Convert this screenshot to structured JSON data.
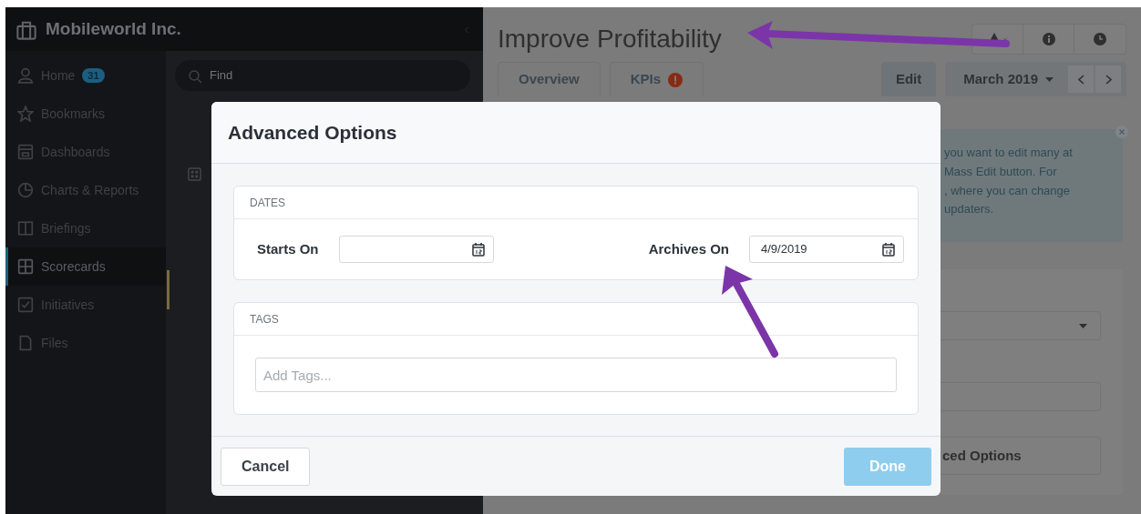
{
  "sidebar": {
    "org_name": "Mobileworld Inc.",
    "items": [
      {
        "label": "Home",
        "badge": "31",
        "selected": false
      },
      {
        "label": "Bookmarks",
        "selected": false
      },
      {
        "label": "Dashboards",
        "selected": false
      },
      {
        "label": "Charts & Reports",
        "selected": false
      },
      {
        "label": "Briefings",
        "selected": false
      },
      {
        "label": "Scorecards",
        "selected": true
      },
      {
        "label": "Initiatives",
        "selected": false
      },
      {
        "label": "Files",
        "selected": false
      }
    ]
  },
  "panel": {
    "search": {
      "placeholder": "Find"
    }
  },
  "page": {
    "title": "Improve Profitability",
    "tabs": [
      {
        "label": "Overview",
        "selected": false,
        "alert": false
      },
      {
        "label": "KPIs",
        "selected": false,
        "alert": true
      }
    ],
    "edit_button": "Edit",
    "period": "March 2019",
    "notice": "you want to edit many at\nMass Edit button. For\n, where you can change\nupdaters.",
    "options_button": "ced Options"
  },
  "modal": {
    "title": "Advanced Options",
    "sections": [
      {
        "kind": "dates",
        "heading": "DATES",
        "fields": [
          {
            "label": "Starts On"
          },
          {
            "label": "Archives On",
            "value": "4/9/2019"
          }
        ]
      },
      {
        "kind": "tags",
        "heading": "TAGS",
        "placeholder": "Add Tags..."
      }
    ],
    "cancel_button": "Cancel",
    "done_button": {
      "label": "Done",
      "disabled": true
    }
  }
}
